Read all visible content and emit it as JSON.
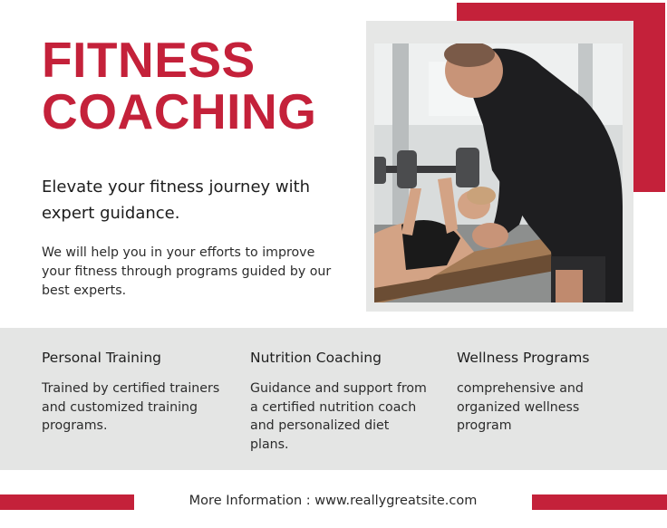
{
  "headline": {
    "line1": "FITNESS",
    "line2": "COACHING"
  },
  "tagline": "Elevate your fitness journey with expert guidance.",
  "intro": "We will help you in your efforts to improve your fitness through programs guided by our best experts.",
  "services": [
    {
      "title": "Personal Training",
      "description": "Trained by certified trainers  and customized training programs."
    },
    {
      "title": "Nutrition Coaching",
      "description": "Guidance and support from a certified nutrition coach and personalized diet plans."
    },
    {
      "title": "Wellness Programs",
      "description": "comprehensive and organized wellness program"
    }
  ],
  "footer": {
    "info": "More Information : www.reallygreatsite.com"
  },
  "colors": {
    "accent": "#c4213a",
    "band": "#e4e5e4",
    "frame": "#e6e7e6"
  },
  "photo": {
    "icon": "coach-spotting-dumbbell-photo"
  }
}
